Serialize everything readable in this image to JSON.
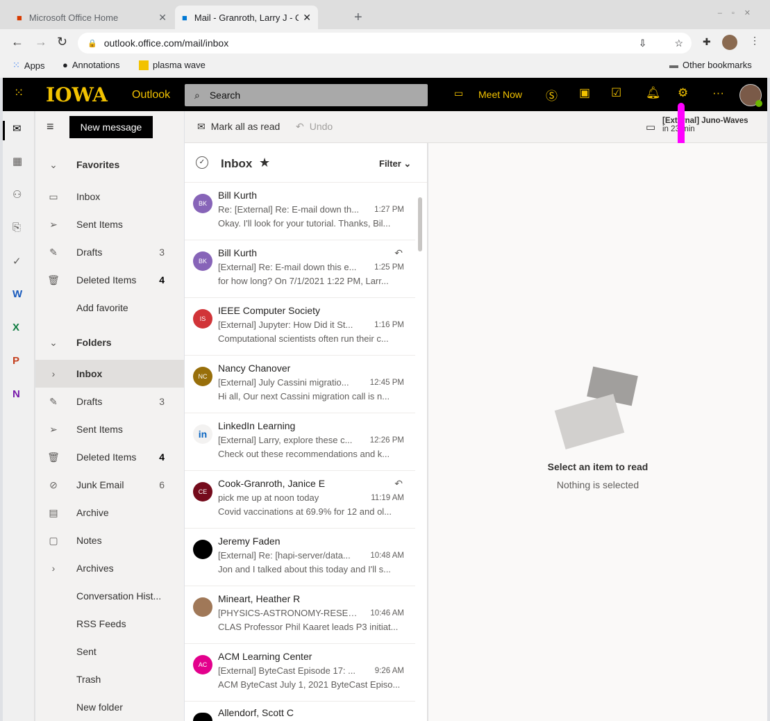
{
  "browser": {
    "tabs": [
      {
        "title": "Microsoft Office Home"
      },
      {
        "title": "Mail - Granroth, Larry J - Outlo"
      }
    ],
    "url": "outlook.office.com/mail/inbox",
    "bookmarks": [
      "Apps",
      "Annotations",
      "plasma wave"
    ],
    "other_bookmarks": "Other bookmarks"
  },
  "header": {
    "logo": "IOWA",
    "app": "Outlook",
    "search_placeholder": "Search",
    "meet_now": "Meet Now",
    "more": "···"
  },
  "toolbar": {
    "new_message": "New message",
    "mark_all_read": "Mark all as read",
    "undo": "Undo",
    "reminder_title": "[External] Juno-Waves",
    "reminder_time": "in 23 min"
  },
  "folders": {
    "favorites_header": "Favorites",
    "favorites": [
      {
        "label": "Inbox",
        "count": ""
      },
      {
        "label": "Sent Items",
        "count": ""
      },
      {
        "label": "Drafts",
        "count": "3"
      },
      {
        "label": "Deleted Items",
        "count": "4"
      },
      {
        "label": "Add favorite",
        "count": ""
      }
    ],
    "folders_header": "Folders",
    "items": [
      {
        "label": "Inbox",
        "count": ""
      },
      {
        "label": "Drafts",
        "count": "3"
      },
      {
        "label": "Sent Items",
        "count": ""
      },
      {
        "label": "Deleted Items",
        "count": "4"
      },
      {
        "label": "Junk Email",
        "count": "6"
      },
      {
        "label": "Archive",
        "count": ""
      },
      {
        "label": "Notes",
        "count": ""
      },
      {
        "label": "Archives",
        "count": ""
      },
      {
        "label": "Conversation Hist...",
        "count": ""
      },
      {
        "label": "RSS Feeds",
        "count": ""
      },
      {
        "label": "Sent",
        "count": ""
      },
      {
        "label": "Trash",
        "count": ""
      },
      {
        "label": "New folder",
        "count": ""
      }
    ]
  },
  "list": {
    "title": "Inbox",
    "filter": "Filter",
    "messages": [
      {
        "initials": "BK",
        "color": "#8764b8",
        "sender": "Bill Kurth",
        "subject": "Re: [External] Re: E-mail down th...",
        "time": "1:27 PM",
        "preview": "Okay. I'll look for your tutorial. Thanks, Bil..."
      },
      {
        "initials": "BK",
        "color": "#8764b8",
        "sender": "Bill Kurth",
        "subject": "[External] Re: E-mail down this e...",
        "time": "1:25 PM",
        "preview": "for how long? On 7/1/2021 1:22 PM, Larr...",
        "replied": true
      },
      {
        "initials": "IS",
        "color": "#d13438",
        "sender": "IEEE Computer Society",
        "subject": "[External] Jupyter: How Did it St...",
        "time": "1:16 PM",
        "preview": "Computational scientists often run their c..."
      },
      {
        "initials": "NC",
        "color": "#986f0b",
        "sender": "Nancy Chanover",
        "subject": "[External] July Cassini migratio...",
        "time": "12:45 PM",
        "preview": "Hi all, Our next Cassini migration call is n..."
      },
      {
        "initials": "in",
        "color": "#f3f2f1",
        "sender": "LinkedIn Learning",
        "subject": "[External] Larry, explore these c...",
        "time": "12:26 PM",
        "preview": "Check out these recommendations and k..."
      },
      {
        "initials": "CE",
        "color": "#750b1c",
        "sender": "Cook-Granroth, Janice E",
        "subject": "pick me up at noon today",
        "time": "11:19 AM",
        "preview": "Covid vaccinations at 69.9% for 12 and ol...",
        "replied": true
      },
      {
        "initials": "",
        "color": "#000000",
        "sender": "Jeremy Faden",
        "subject": "[External] Re: [hapi-server/data...",
        "time": "10:48 AM",
        "preview": "Jon and I talked about this today and I'll s..."
      },
      {
        "initials": "",
        "color": "#a07858",
        "sender": "Mineart, Heather R",
        "subject": "[PHYSICS-ASTRONOMY-RESEA...",
        "time": "10:46 AM",
        "preview": "CLAS Professor Phil Kaaret leads P3 initiat..."
      },
      {
        "initials": "AC",
        "color": "#e3008c",
        "sender": "ACM Learning Center",
        "subject": "[External] ByteCast Episode 17: ...",
        "time": "9:26 AM",
        "preview": "ACM ByteCast July 1, 2021 ByteCast Episo..."
      },
      {
        "initials": "",
        "color": "#000000",
        "sender": "Allendorf, Scott C",
        "subject": "",
        "time": "",
        "preview": ""
      }
    ]
  },
  "reading": {
    "title": "Select an item to read",
    "subtitle": "Nothing is selected"
  }
}
